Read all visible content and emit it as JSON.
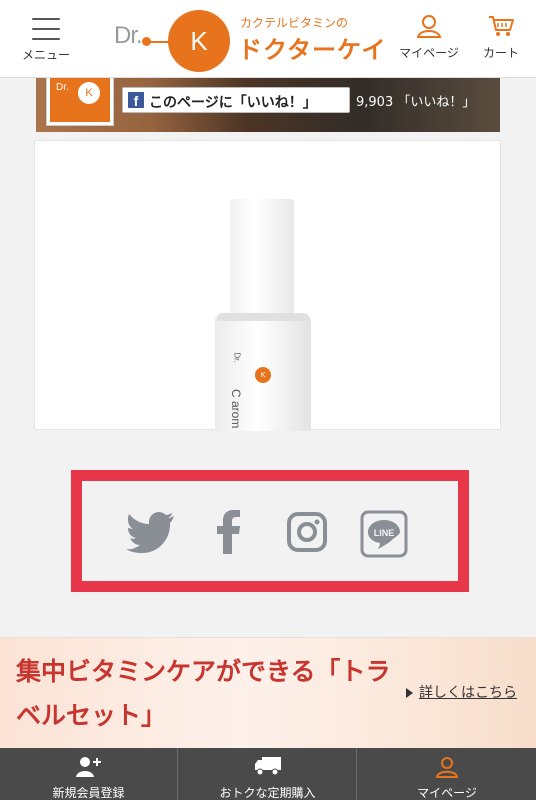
{
  "header": {
    "menu_label": "メニュー",
    "logo": {
      "dr_text": "Dr.",
      "circle_letter": "K",
      "tagline": "カクテルビタミンの",
      "brand": "ドクターケイ"
    },
    "mypage_label": "マイページ",
    "cart_label": "カート"
  },
  "facebook": {
    "logo_dr": "Dr.",
    "logo_k": "K",
    "like_icon": "f",
    "like_label": "このページに「いいね！」",
    "count_label": "9,903 「いいね！」"
  },
  "product": {
    "bottle_brand": "Dr.",
    "bottle_mark": "K",
    "bottle_text": "C arom"
  },
  "social": {
    "icons": [
      "twitter-icon",
      "facebook-icon",
      "instagram-icon",
      "line-icon"
    ],
    "line_text": "LINE"
  },
  "banner": {
    "title": "集中ビタミンケアができる「トラベルセット」",
    "more_label": "詳しくはこちら"
  },
  "bottom_nav": {
    "items": [
      {
        "label": "新規会員登録"
      },
      {
        "label": "おトクな定期購入"
      },
      {
        "label": "マイページ"
      }
    ]
  },
  "colors": {
    "accent": "#e8731d",
    "highlight_frame": "#e8364a",
    "banner_text": "#c8352f",
    "icon_gray": "#8a8f96",
    "nav_bg": "#4a4a4a"
  }
}
